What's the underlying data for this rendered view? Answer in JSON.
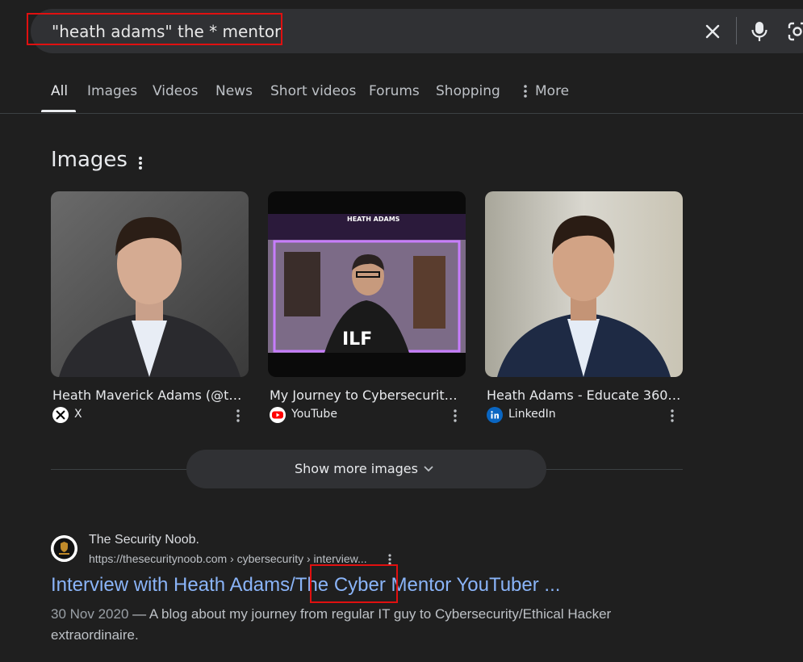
{
  "search": {
    "query": "\"heath adams\" the * mentor",
    "clear_icon": "close-icon",
    "mic_icon": "microphone-icon",
    "lens_icon": "camera-lens-icon"
  },
  "tabs": [
    {
      "label": "All",
      "active": true
    },
    {
      "label": "Images"
    },
    {
      "label": "Videos"
    },
    {
      "label": "News"
    },
    {
      "label": "Short videos"
    },
    {
      "label": "Forums"
    },
    {
      "label": "Shopping"
    },
    {
      "label": "More"
    }
  ],
  "images_section": {
    "heading": "Images",
    "cards": [
      {
        "title": "Heath Maverick Adams (@the...",
        "source": "X",
        "source_icon": "x-logo-icon"
      },
      {
        "title": "My Journey to Cybersecurity ...",
        "source": "YouTube",
        "source_icon": "youtube-logo-icon",
        "banner": "HEATH ADAMS"
      },
      {
        "title": "Heath Adams - Educate 360 |...",
        "source": "LinkedIn",
        "source_icon": "linkedin-logo-icon"
      }
    ],
    "show_more_label": "Show more images"
  },
  "result": {
    "site_name": "The Security Noob.",
    "url": "https://thesecuritynoob.com › cybersecurity › interview...",
    "title": "Interview with Heath Adams/The Cyber Mentor YouTuber ...",
    "date": "30 Nov 2020",
    "snippet": "A blog about my journey from regular IT guy to Cybersecurity/Ethical Hacker extraordinaire."
  },
  "colors": {
    "background": "#1f1f1f",
    "link": "#8ab4f8",
    "highlight_box": "#e01010"
  }
}
